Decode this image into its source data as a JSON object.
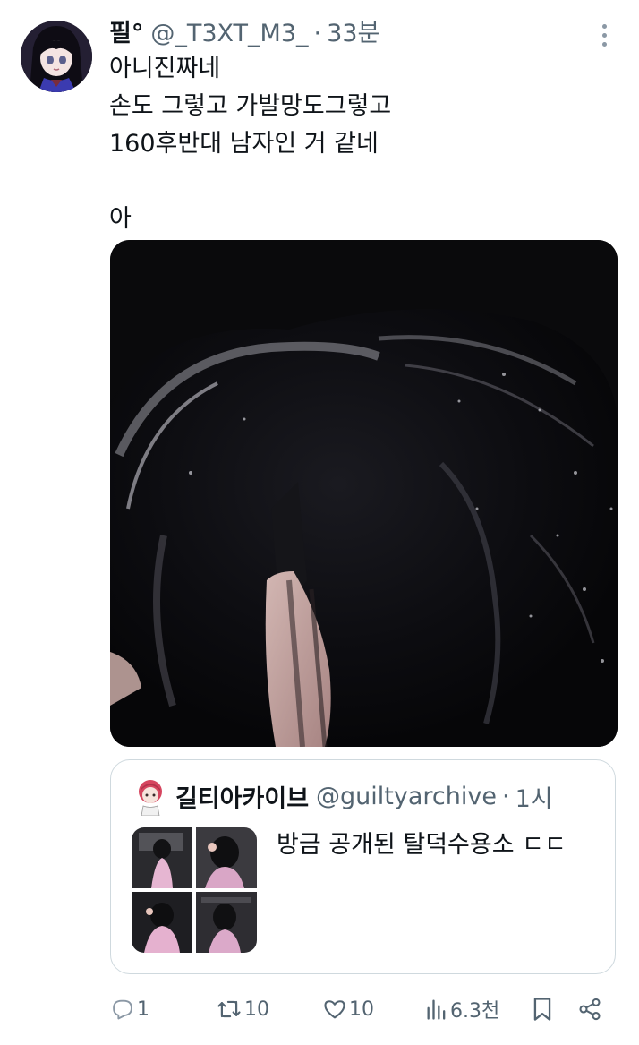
{
  "tweet": {
    "author": {
      "display_name": "필°",
      "handle": "@_T3XT_M3_",
      "time_separator": "·",
      "time": "33분"
    },
    "text_lines": [
      "아니진짜네",
      "손도 그렇고 가발망도그렇고",
      "160후반대 남자인 거 같네",
      "",
      "아"
    ],
    "quote": {
      "display_name": "길티아카이브",
      "handle": "@guiltyarchive",
      "time_separator": "·",
      "time": "1시",
      "text": "방금 공개된 탈덕수용소 ㄷㄷ"
    },
    "actions": {
      "reply": {
        "icon": "reply-icon",
        "count": "1"
      },
      "retweet": {
        "icon": "retweet-icon",
        "count": "10"
      },
      "like": {
        "icon": "heart-icon",
        "count": "10"
      },
      "views": {
        "icon": "views-icon",
        "count": "6.3천"
      },
      "bookmark": {
        "icon": "bookmark-icon"
      },
      "share": {
        "icon": "share-icon"
      }
    }
  },
  "colors": {
    "text": "#0f1419",
    "secondary": "#536471",
    "border": "#cfd9de",
    "background": "#ffffff"
  }
}
